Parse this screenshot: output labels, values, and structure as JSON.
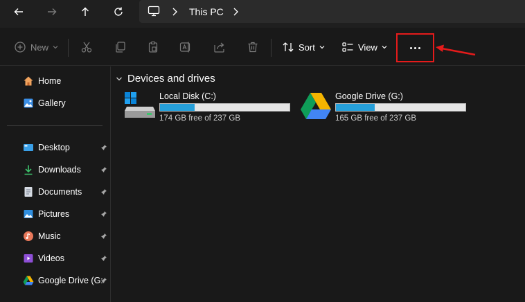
{
  "address": {
    "breadcrumb": "This PC",
    "icons": [
      "back-arrow-icon",
      "forward-arrow-icon",
      "up-arrow-icon",
      "refresh-icon",
      "monitor-icon",
      "chevron-right-icon"
    ]
  },
  "toolbar": {
    "new_label": "New",
    "sort_label": "Sort",
    "view_label": "View",
    "icons": [
      "cut-icon",
      "copy-icon",
      "paste-icon",
      "rename-icon",
      "share-icon",
      "delete-icon",
      "more-options-icon"
    ]
  },
  "sidebar": {
    "items": [
      {
        "label": "Home",
        "icon": "home-icon"
      },
      {
        "label": "Gallery",
        "icon": "gallery-icon"
      },
      {
        "label": "Desktop",
        "icon": "desktop-icon",
        "pinned": true
      },
      {
        "label": "Downloads",
        "icon": "download-icon",
        "pinned": true
      },
      {
        "label": "Documents",
        "icon": "documents-icon",
        "pinned": true
      },
      {
        "label": "Pictures",
        "icon": "pictures-icon",
        "pinned": true
      },
      {
        "label": "Music",
        "icon": "music-icon",
        "pinned": true
      },
      {
        "label": "Videos",
        "icon": "videos-icon",
        "pinned": true
      },
      {
        "label": "Google Drive (G:",
        "icon": "google-drive-icon",
        "pinned": true
      }
    ]
  },
  "main": {
    "group_title": "Devices and drives",
    "drives": [
      {
        "name": "Local Disk (C:)",
        "free_text": "174 GB free of 237 GB",
        "used_fraction": 0.27,
        "icon": "local-disk-icon"
      },
      {
        "name": "Google Drive (G:)",
        "free_text": "165 GB free of 237 GB",
        "used_fraction": 0.3,
        "icon": "google-drive-icon"
      }
    ]
  },
  "colors": {
    "accent": "#26a0da",
    "highlight_box": "#e51b1b",
    "background": "#191919"
  }
}
